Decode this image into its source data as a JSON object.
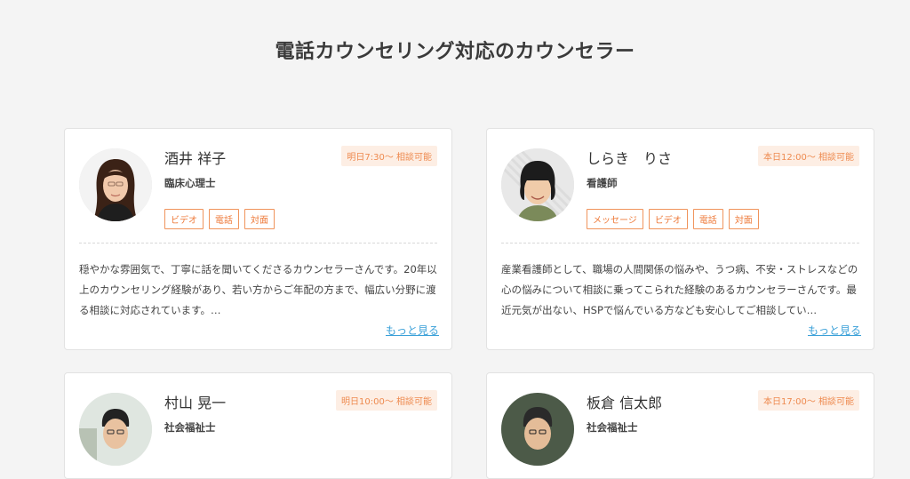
{
  "page": {
    "title": "電話カウンセリング対応のカウンセラー"
  },
  "counselors": [
    {
      "name": "酒井 祥子",
      "role": "臨床心理士",
      "availability": "明日7:30〜 相談可能",
      "tags": [
        "ビデオ",
        "電話",
        "対面"
      ],
      "description": "穏やかな雰囲気で、丁寧に話を聞いてくださるカウンセラーさんです。20年以上のカウンセリング経験があり、若い方からご年配の方まで、幅広い分野に渡る相談に対応されています。…",
      "more_label": "もっと見る"
    },
    {
      "name": "しらき　りさ",
      "role": "看護師",
      "availability": "本日12:00〜 相談可能",
      "tags": [
        "メッセージ",
        "ビデオ",
        "電話",
        "対面"
      ],
      "description": "産業看護師として、職場の人間関係の悩みや、うつ病、不安・ストレスなどの心の悩みについて相談に乗ってこられた経験のあるカウンセラーさんです。最近元気が出ない、HSPで悩んでいる方なども安心してご相談してい…",
      "more_label": "もっと見る"
    },
    {
      "name": "村山 晃一",
      "role": "社会福祉士",
      "availability": "明日10:00〜 相談可能"
    },
    {
      "name": "板倉 信太郎",
      "role": "社会福祉士",
      "availability": "本日17:00〜 相談可能"
    }
  ],
  "colors": {
    "accent": "#ee8a4f",
    "badge_bg": "#fdeee4",
    "link": "#3aa0d8"
  }
}
